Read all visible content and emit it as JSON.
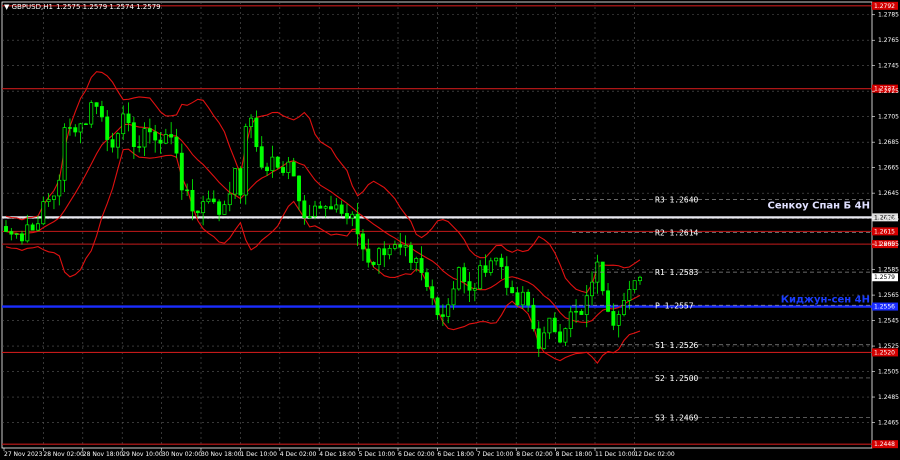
{
  "chart_data": {
    "type": "candlestick",
    "symbol": "GBPUSD,H1",
    "ohlc": "1.2575 1.2579 1.2574 1.2579",
    "ylim": [
      1.2445,
      1.2795
    ],
    "y_ticks": [
      1.2785,
      1.2765,
      1.2745,
      1.2725,
      1.2705,
      1.2685,
      1.2665,
      1.2645,
      1.2625,
      1.2605,
      1.2585,
      1.2565,
      1.2545,
      1.2525,
      1.2505,
      1.2485,
      1.2465
    ],
    "x_labels": [
      "27 Nov 2023",
      "28 Nov 02:00",
      "28 Nov 18:00",
      "29 Nov 10:00",
      "30 Nov 02:00",
      "30 Nov 18:00",
      "1 Dec 10:00",
      "4 Dec 02:00",
      "4 Dec 18:00",
      "5 Dec 10:00",
      "6 Dec 02:00",
      "6 Dec 18:00",
      "7 Dec 10:00",
      "8 Dec 02:00",
      "8 Dec 18:00",
      "11 Dec 10:00",
      "12 Dec 02:00"
    ],
    "red_levels": [
      {
        "value": 1.2792,
        "label": "1.2792"
      },
      {
        "value": 1.2727,
        "label": "1.2727"
      },
      {
        "value": 1.2615,
        "label": "1.2615"
      },
      {
        "value": 1.2605,
        "label": "1.2605"
      },
      {
        "value": 1.252,
        "label": "1.2520"
      },
      {
        "value": 1.2448,
        "label": "1.2448"
      }
    ],
    "senkou": {
      "value": 1.2626,
      "label": "1.2626",
      "name": "Сенкоу Спан Б 4Н"
    },
    "kijun": {
      "value": 1.2556,
      "label": "1.2556",
      "name": "Киджун-сен 4Н"
    },
    "current": {
      "value": 1.2579,
      "label": "1.2579"
    },
    "pivots": [
      {
        "name": "R3",
        "value": "1.2640",
        "v": 1.264
      },
      {
        "name": "R2",
        "value": "1.2614",
        "v": 1.2614
      },
      {
        "name": "R1",
        "value": "1.2583",
        "v": 1.2583
      },
      {
        "name": "P",
        "value": "1.2557",
        "v": 1.2557
      },
      {
        "name": "S1",
        "value": "1.2526",
        "v": 1.2526
      },
      {
        "name": "S2",
        "value": "1.2500",
        "v": 1.25
      },
      {
        "name": "S3",
        "value": "1.2469",
        "v": 1.2469
      }
    ],
    "price_path": [
      1.2615,
      1.2612,
      1.2618,
      1.261,
      1.2622,
      1.2615,
      1.2628,
      1.2635,
      1.264,
      1.2645,
      1.2662,
      1.2705,
      1.269,
      1.2702,
      1.2698,
      1.2705,
      1.272,
      1.2715,
      1.2695,
      1.268,
      1.269,
      1.2705,
      1.2698,
      1.269,
      1.268,
      1.2685,
      1.27,
      1.269,
      1.2682,
      1.2688,
      1.2692,
      1.269,
      1.264,
      1.265,
      1.2635,
      1.2628,
      1.264,
      1.2645,
      1.2635,
      1.263,
      1.2638,
      1.265,
      1.266,
      1.2645,
      1.27,
      1.2705,
      1.268,
      1.266,
      1.2665,
      1.2672,
      1.266,
      1.2668,
      1.2675,
      1.265,
      1.264,
      1.2625,
      1.263,
      1.2635,
      1.2628,
      1.263,
      1.264,
      1.2632,
      1.2625,
      1.2628,
      1.2618,
      1.2605,
      1.2595,
      1.259,
      1.2598,
      1.26,
      1.2605,
      1.2602,
      1.2598,
      1.26,
      1.2585,
      1.259,
      1.258,
      1.257,
      1.2562,
      1.2555,
      1.255,
      1.256,
      1.2575,
      1.259,
      1.257,
      1.2565,
      1.2575,
      1.2585,
      1.259,
      1.2595,
      1.2592,
      1.2586,
      1.257,
      1.2555,
      1.256,
      1.2565,
      1.2548,
      1.253,
      1.2525,
      1.254,
      1.2545,
      1.253,
      1.254,
      1.2548,
      1.2552,
      1.2545,
      1.2555,
      1.2575,
      1.259,
      1.2575,
      1.256,
      1.2545,
      1.2555,
      1.256,
      1.2565,
      1.2572,
      1.2579
    ],
    "candle_count": 120
  }
}
